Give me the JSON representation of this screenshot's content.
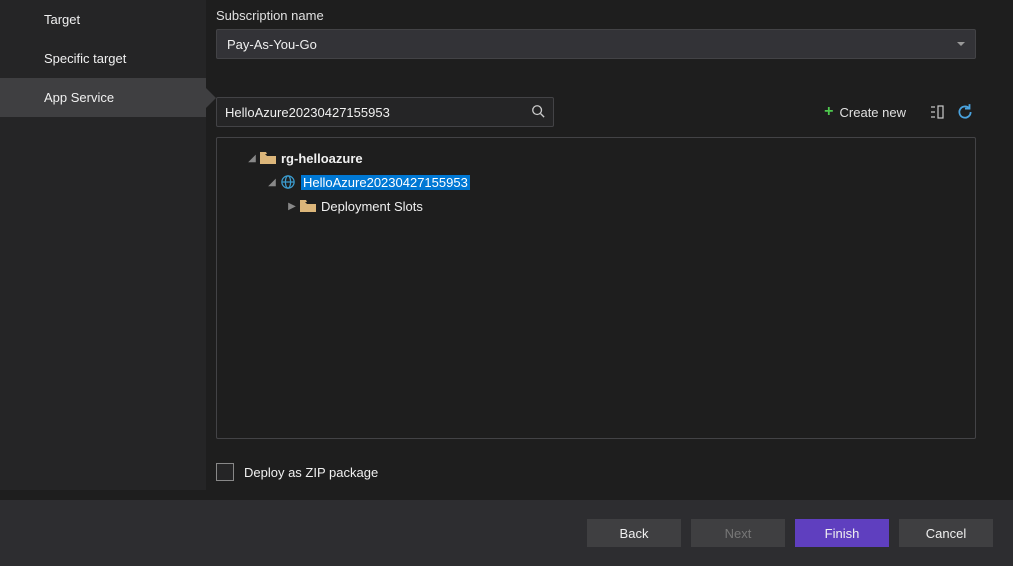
{
  "sidebar": {
    "items": [
      {
        "label": "Target"
      },
      {
        "label": "Specific target"
      },
      {
        "label": "App Service"
      }
    ],
    "active_index": 2
  },
  "subscription": {
    "label": "Subscription name",
    "value": "Pay-As-You-Go"
  },
  "search": {
    "value": "HelloAzure20230427155953"
  },
  "actions": {
    "create_new": "Create new"
  },
  "tree": {
    "rg": "rg-helloazure",
    "app": "HelloAzure20230427155953",
    "slots": "Deployment Slots"
  },
  "deploy_zip": {
    "label": "Deploy as ZIP package",
    "checked": false
  },
  "buttons": {
    "back": "Back",
    "next": "Next",
    "finish": "Finish",
    "cancel": "Cancel"
  }
}
